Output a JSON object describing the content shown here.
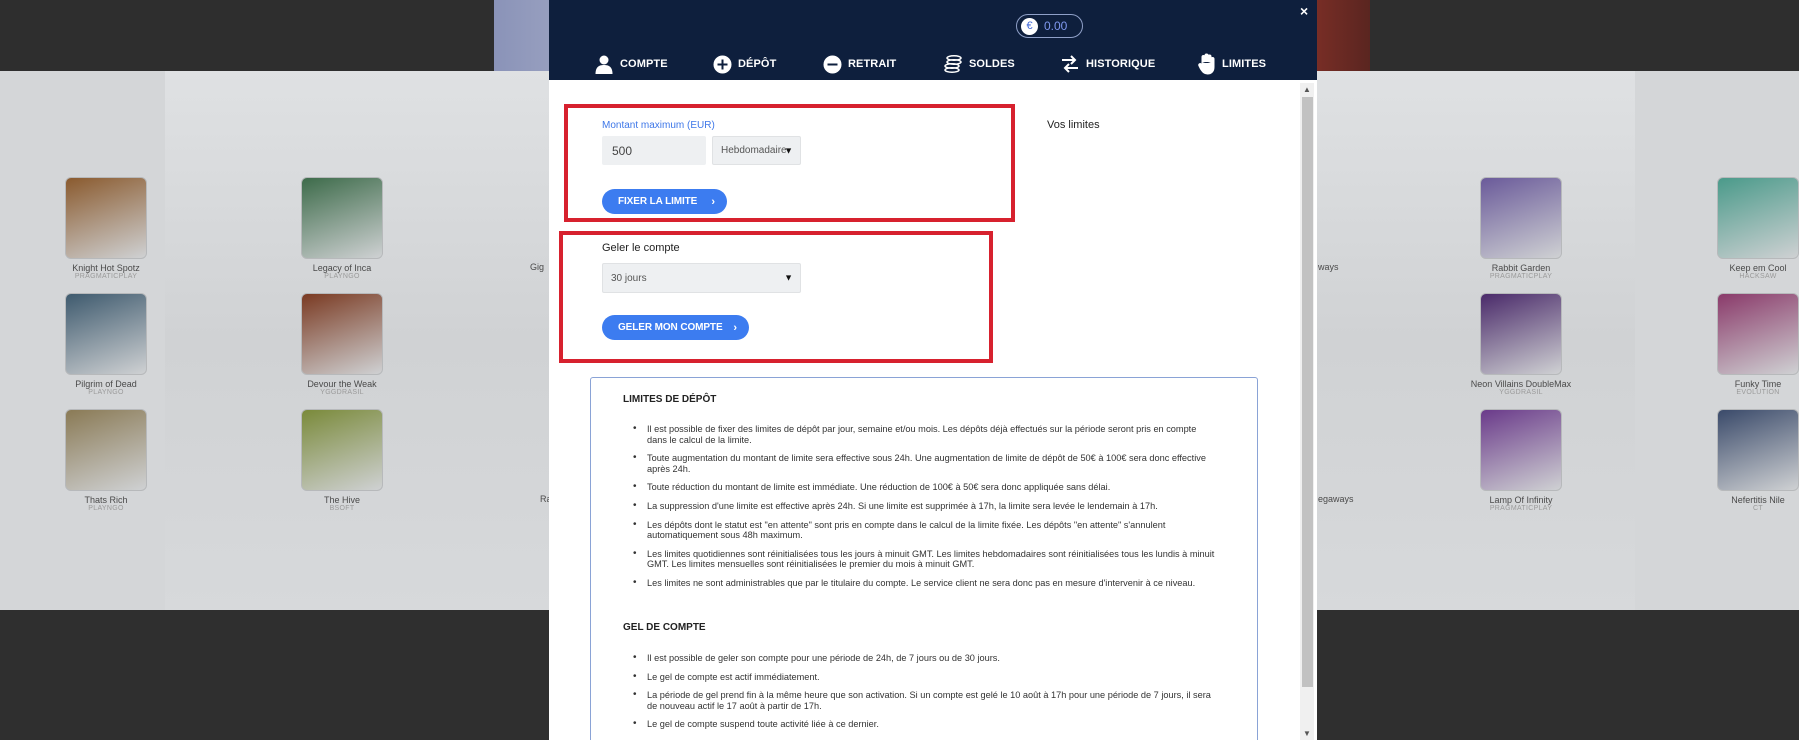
{
  "header": {
    "balance": "0.00",
    "currency_symbol": "€",
    "close_label": "×"
  },
  "tabs": [
    {
      "label": "COMPTE",
      "icon": "user-icon"
    },
    {
      "label": "DÉPÔT",
      "icon": "plus-circle-icon"
    },
    {
      "label": "RETRAIT",
      "icon": "minus-circle-icon"
    },
    {
      "label": "SOLDES",
      "icon": "coins-icon"
    },
    {
      "label": "HISTORIQUE",
      "icon": "swap-arrows-icon"
    },
    {
      "label": "LIMITES",
      "icon": "hand-icon",
      "active": true
    }
  ],
  "limit_form": {
    "label": "Montant maximum (EUR)",
    "amount_value": "500",
    "period_selected": "Hebdomadaire",
    "submit_label": "FIXER LA LIMITE"
  },
  "your_limits": {
    "title": "Vos limites"
  },
  "freeze_form": {
    "label": "Geler le compte",
    "duration_selected": "30 jours",
    "submit_label": "GELER MON COMPTE"
  },
  "info": {
    "deposit_title": "LIMITES DE DÉPÔT",
    "deposit_rules": [
      "Il est possible de fixer des limites de dépôt par jour, semaine et/ou mois. Les dépôts déjà effectués sur la période seront pris en compte dans le calcul de la limite.",
      "Toute augmentation du montant de limite sera effective sous 24h. Une augmentation de limite de dépôt de 50€ à 100€ sera donc effective après 24h.",
      "Toute réduction du montant de limite est immédiate. Une réduction de 100€ à 50€ sera donc appliquée sans délai.",
      "La suppression d'une limite est effective après 24h. Si une limite est supprimée à 17h, la limite sera levée le lendemain à 17h.",
      "Les dépôts dont le statut est \"en attente\" sont pris en compte dans le calcul de la limite fixée. Les dépôts \"en attente\" s'annulent automatiquement sous 48h maximum.",
      "Les limites quotidiennes sont réinitialisées tous les jours à minuit GMT. Les limites hebdomadaires sont réinitialisées tous les lundis à minuit GMT. Les limites mensuelles sont réinitialisées le premier du mois à minuit GMT.",
      "Les limites ne sont administrables que par le titulaire du compte. Le service client ne sera donc pas en mesure d'intervenir à ce niveau."
    ],
    "freeze_title": "GEL DE COMPTE",
    "freeze_rules": [
      "Il est possible de geler son compte pour une période de 24h, de 7 jours ou de 30 jours.",
      "Le gel de compte est actif immédiatement.",
      "La période de gel prend fin à la même heure que son activation. Si un compte est gelé le 10 août à 17h pour une période de 7 jours, il sera de nouveau actif le 17 août à partir de 17h.",
      "Le gel de compte suspend toute activité liée à ce dernier."
    ]
  },
  "background_games": [
    {
      "name": "Knight Hot Spotz",
      "provider": "PRAGMATICPLAY",
      "color": "#8a5a2e"
    },
    {
      "name": "Legacy of Inca",
      "provider": "PLAYNGO",
      "color": "#3d6b4a"
    },
    {
      "name": "Pilgrim of Dead",
      "provider": "PLAYNGO",
      "color": "#3e5a6e"
    },
    {
      "name": "Devour the Weak",
      "provider": "YGGDRASIL",
      "color": "#7a3a22"
    },
    {
      "name": "Thats Rich",
      "provider": "PLAYNGO",
      "color": "#8a7a55"
    },
    {
      "name": "The Hive",
      "provider": "BSOFT",
      "color": "#7a8a3a"
    },
    {
      "name": "Rabbit Garden",
      "provider": "PRAGMATICPLAY",
      "color": "#6a5a9a"
    },
    {
      "name": "Keep em Cool",
      "provider": "HACKSAW",
      "color": "#4a9a8a"
    },
    {
      "name": "Neon Villains DoubleMax",
      "provider": "YGGDRASIL",
      "color": "#4a2a6a"
    },
    {
      "name": "Funky Time",
      "provider": "EVOLUTION",
      "color": "#8a3a6a"
    },
    {
      "name": "Lamp Of Infinity",
      "provider": "PRAGMATICPLAY",
      "color": "#6a3a8a"
    },
    {
      "name": "Nefertitis Nile",
      "provider": "CT",
      "color": "#3a4a6a"
    }
  ],
  "background_partial": [
    "Gig",
    "W",
    "Ra",
    "ways",
    "egaways"
  ]
}
